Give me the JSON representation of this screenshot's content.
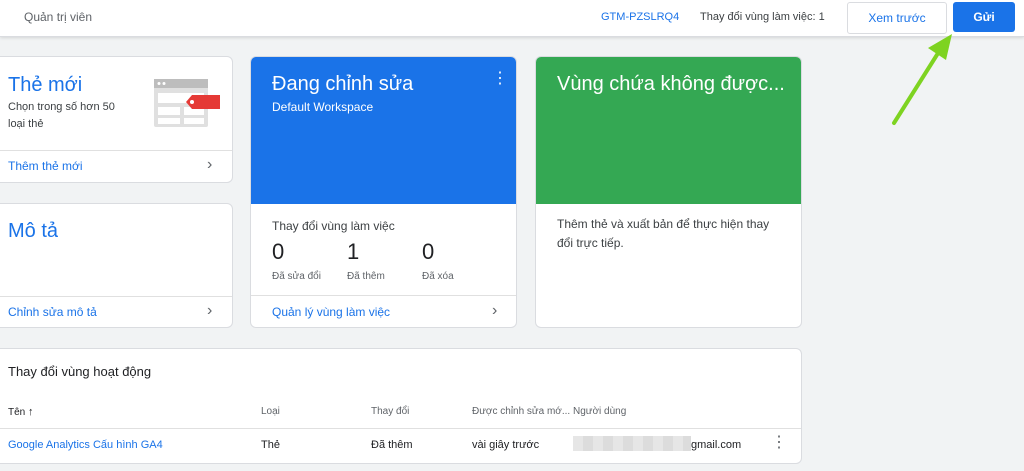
{
  "topbar": {
    "title": "Quản trị viên",
    "container_id": "GTM-PZSLRQ4",
    "workspace_changes": "Thay đổi vùng làm việc: 1",
    "preview_label": "Xem trước",
    "submit_label": "Gửi"
  },
  "new_tag_card": {
    "title": "Thẻ mới",
    "description": "Chọn trong số hơn 50 loại thẻ",
    "link": "Thêm thẻ mới"
  },
  "description_card": {
    "title": "Mô tả",
    "link": "Chỉnh sửa mô tả"
  },
  "editing_card": {
    "title": "Đang chỉnh sửa",
    "subtitle": "Default Workspace",
    "section_label": "Thay đổi vùng làm việc",
    "stats": [
      {
        "value": "0",
        "label": "Đã sửa đổi"
      },
      {
        "value": "1",
        "label": "Đã thêm"
      },
      {
        "value": "0",
        "label": "Đã xóa"
      }
    ],
    "link": "Quản lý vùng làm việc"
  },
  "unpublished_card": {
    "title": "Vùng chứa không được...",
    "description": "Thêm thẻ và xuất bản để thực hiện thay đổi trực tiếp."
  },
  "changes_table": {
    "title": "Thay đổi vùng hoạt động",
    "headers": {
      "name": "Tên",
      "type": "Loại",
      "change": "Thay đổi",
      "edited": "Được chỉnh sửa mớ...",
      "user": "Người dùng"
    },
    "rows": [
      {
        "name": "Google Analytics Cấu hình GA4",
        "type": "Thẻ",
        "change": "Đã thêm",
        "edited": "vài giây trước",
        "user": "gmail.com"
      }
    ]
  },
  "colors": {
    "accent": "#1a73e8",
    "editing_header": "#1a73e8",
    "unpublished_header": "#34a853",
    "arrow": "#7ed321"
  }
}
